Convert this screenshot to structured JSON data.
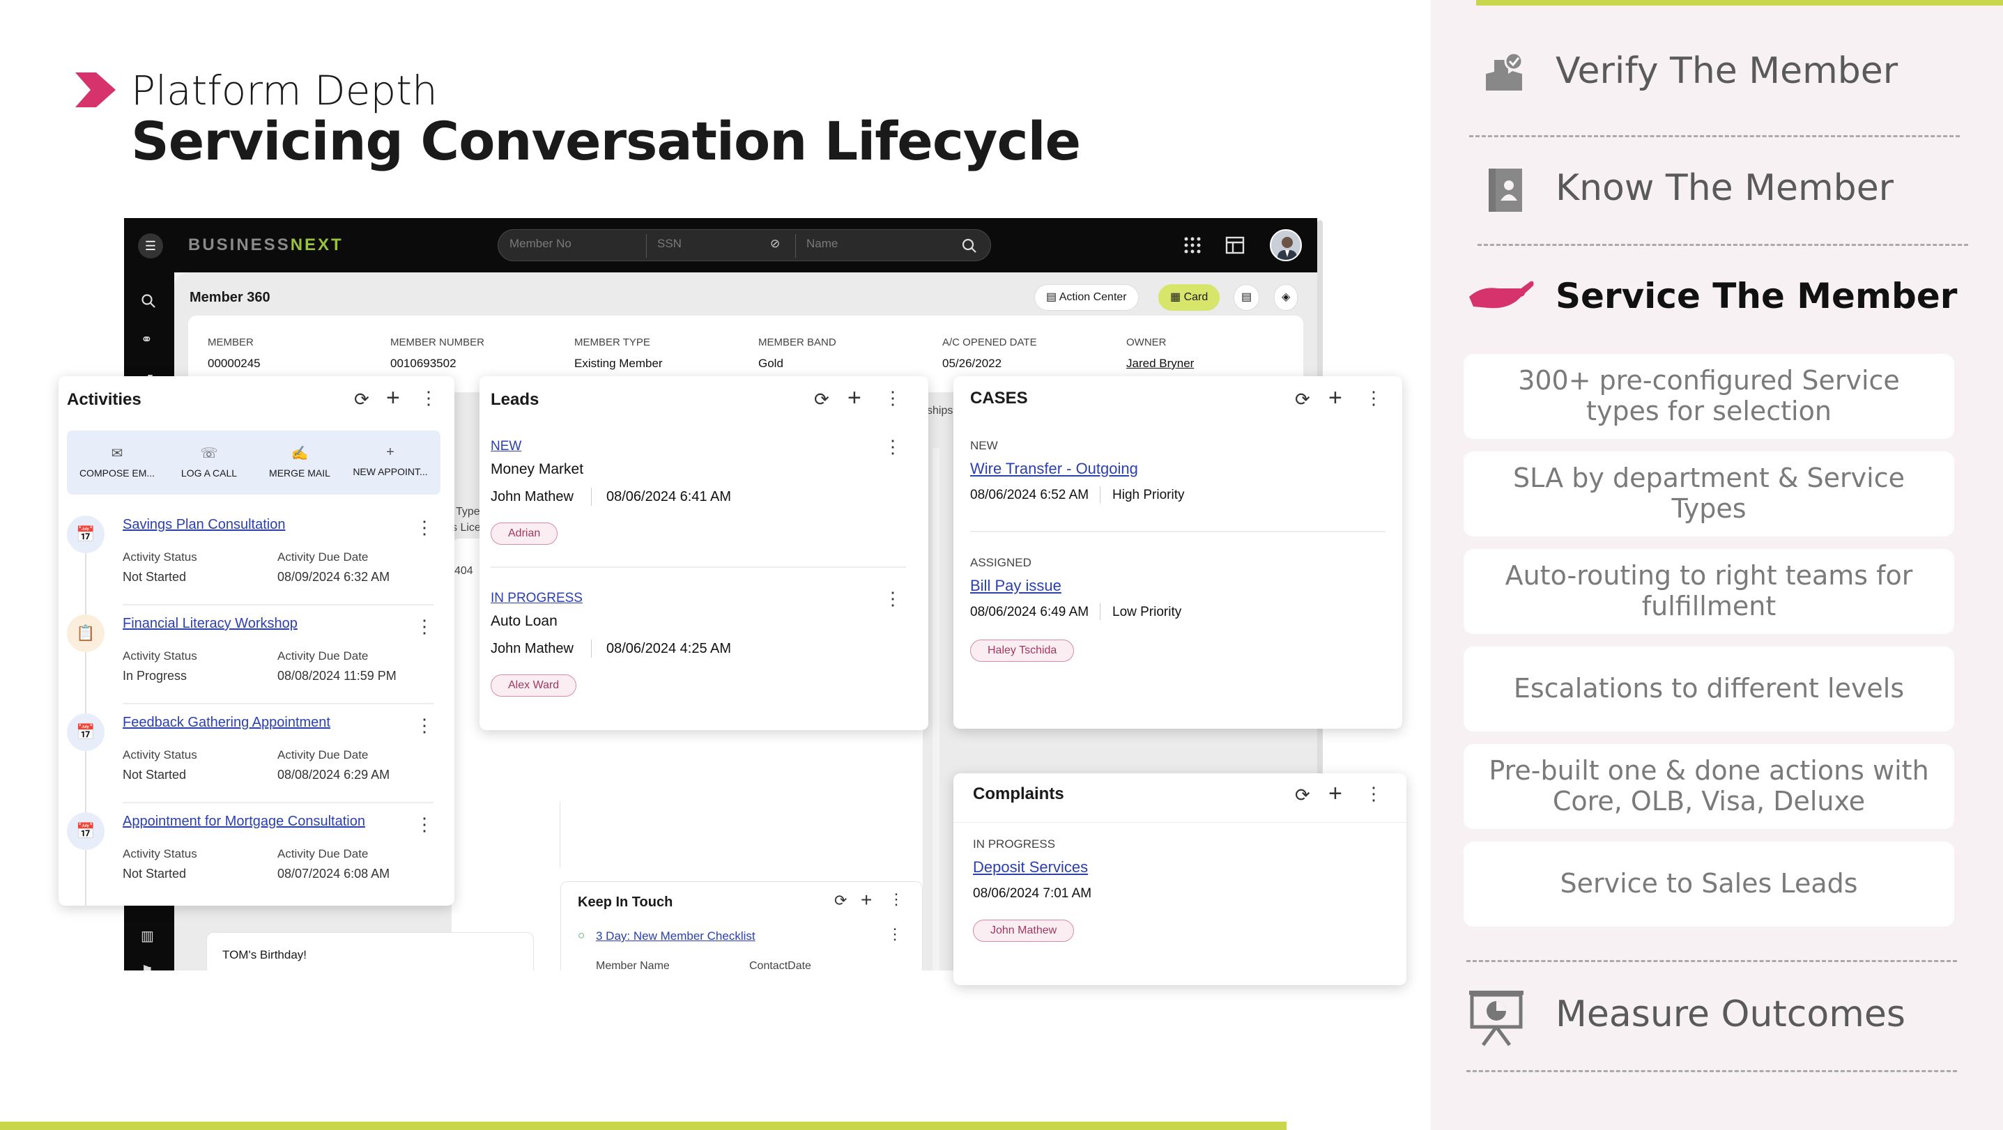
{
  "slide": {
    "kicker": "Platform Depth",
    "title": "Servicing Conversation Lifecycle"
  },
  "app": {
    "brand_a": "BUSINESS",
    "brand_b": "NEXT",
    "search": {
      "member_no": "Member No",
      "ssn": "SSN",
      "name": "Name"
    },
    "page_title": "Member 360",
    "action_center": "Action Center",
    "card_toggle": "Card",
    "member_bar": [
      {
        "label": "MEMBER",
        "value": "00000245"
      },
      {
        "label": "MEMBER NUMBER",
        "value": "0010693502"
      },
      {
        "label": "MEMBER TYPE",
        "value": "Existing Member"
      },
      {
        "label": "MEMBER BAND",
        "value": "Gold"
      },
      {
        "label": "A/C OPENED DATE",
        "value": "05/26/2022"
      },
      {
        "label": "OWNER",
        "value": "Jared Bryner"
      }
    ],
    "bg_fragments": {
      "type": "Type",
      "lice": "s Lice",
      "n404": "404",
      "ships": "ships",
      "birthday": "TOM's Birthday!"
    }
  },
  "activities": {
    "title": "Activities",
    "quick_actions": [
      "COMPOSE EM...",
      "LOG A CALL",
      "MERGE MAIL",
      "NEW APPOINT..."
    ],
    "status_label": "Activity Status",
    "due_label": "Activity Due Date",
    "items": [
      {
        "title": "Savings Plan Consultation",
        "status": "Not Started",
        "due": "08/09/2024 6:32 AM"
      },
      {
        "title": "Financial Literacy Workshop",
        "status": "In Progress",
        "due": "08/08/2024 11:59 PM"
      },
      {
        "title": "Feedback Gathering Appointment",
        "status": "Not Started",
        "due": "08/08/2024 6:29 AM"
      },
      {
        "title": "Appointment for Mortgage Consultation",
        "status": "Not Started",
        "due": "08/07/2024 6:08 AM"
      }
    ]
  },
  "leads": {
    "title": "Leads",
    "items": [
      {
        "status": "NEW",
        "name": "Money Market",
        "person": "John Mathew",
        "date": "08/06/2024 6:41 AM",
        "tag": "Adrian"
      },
      {
        "status": "IN PROGRESS",
        "name": "Auto Loan",
        "person": "John Mathew",
        "date": "08/06/2024 4:25 AM",
        "tag": "Alex Ward"
      }
    ]
  },
  "cases": {
    "title": "CASES",
    "items": [
      {
        "status": "NEW",
        "name": "Wire Transfer - Outgoing",
        "date": "08/06/2024 6:52 AM",
        "priority": "High Priority",
        "tag": ""
      },
      {
        "status": "ASSIGNED",
        "name": "Bill Pay issue",
        "date": "08/06/2024 6:49 AM",
        "priority": "Low Priority",
        "tag": "Haley Tschida"
      }
    ]
  },
  "complaints": {
    "title": "Complaints",
    "status": "IN PROGRESS",
    "name": "Deposit Services",
    "date": "08/06/2024 7:01 AM",
    "tag": "John Mathew"
  },
  "keep_in_touch": {
    "title": "Keep In Touch",
    "item": "3 Day: New Member Checklist",
    "col_a": "Member Name",
    "col_b": "ContactDate"
  },
  "right_panel": {
    "verify": "Verify The Member",
    "know": "Know The Member",
    "service": "Service The Member",
    "features": [
      "300+ pre-configured Service types for selection",
      "SLA by department & Service Types",
      "Auto-routing to right teams for fulfillment",
      "Escalations to different levels",
      "Pre-built one & done actions with Core, OLB, Visa, Deluxe",
      "Service to Sales Leads"
    ],
    "measure": "Measure Outcomes"
  },
  "colors": {
    "accent_pink": "#d6336c",
    "accent_lime": "#c7d64a",
    "panel_bg": "#f8f1f3"
  }
}
